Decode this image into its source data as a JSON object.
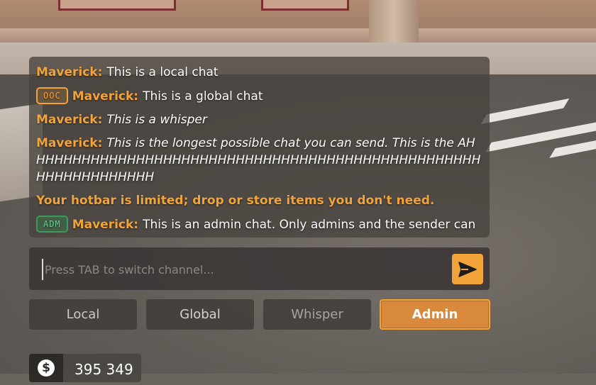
{
  "chat": {
    "messages": [
      {
        "badge": "",
        "name": "Maverick:",
        "text": "This is a local chat",
        "style": "normal"
      },
      {
        "badge": "OOC",
        "name": "Maverick:",
        "text": "This is a global chat",
        "style": "normal"
      },
      {
        "badge": "",
        "name": "Maverick:",
        "text": "This is a whisper",
        "style": "italic"
      },
      {
        "badge": "",
        "name": "Maverick:",
        "text": "This is the longest possible chat you can send. This is the AHHHHHHHHHHHHHHHHHHHHHHHHHHHHHHHHHHHHHHHHHHHHHHHHHHHHHHHHHHHHHHH",
        "style": "italic"
      },
      {
        "system": "Your hotbar is limited; drop or store items you don't need."
      },
      {
        "badge": "ADM",
        "name": "Maverick:",
        "text": "This is an admin chat. Only admins and the sender can",
        "style": "normal"
      }
    ]
  },
  "input": {
    "placeholder": "Press TAB to switch channel...",
    "value": "",
    "send_icon": "send-arrow-icon"
  },
  "channels": {
    "items": [
      "Local",
      "Global",
      "Whisper",
      "Admin"
    ],
    "selected": "Admin"
  },
  "money": {
    "icon": "dollar-icon",
    "symbol": "$",
    "value": "395 349"
  },
  "colors": {
    "accent": "#f2a33a",
    "admin_badge": "#3a9c5a",
    "panel_bg": "#48423e"
  }
}
